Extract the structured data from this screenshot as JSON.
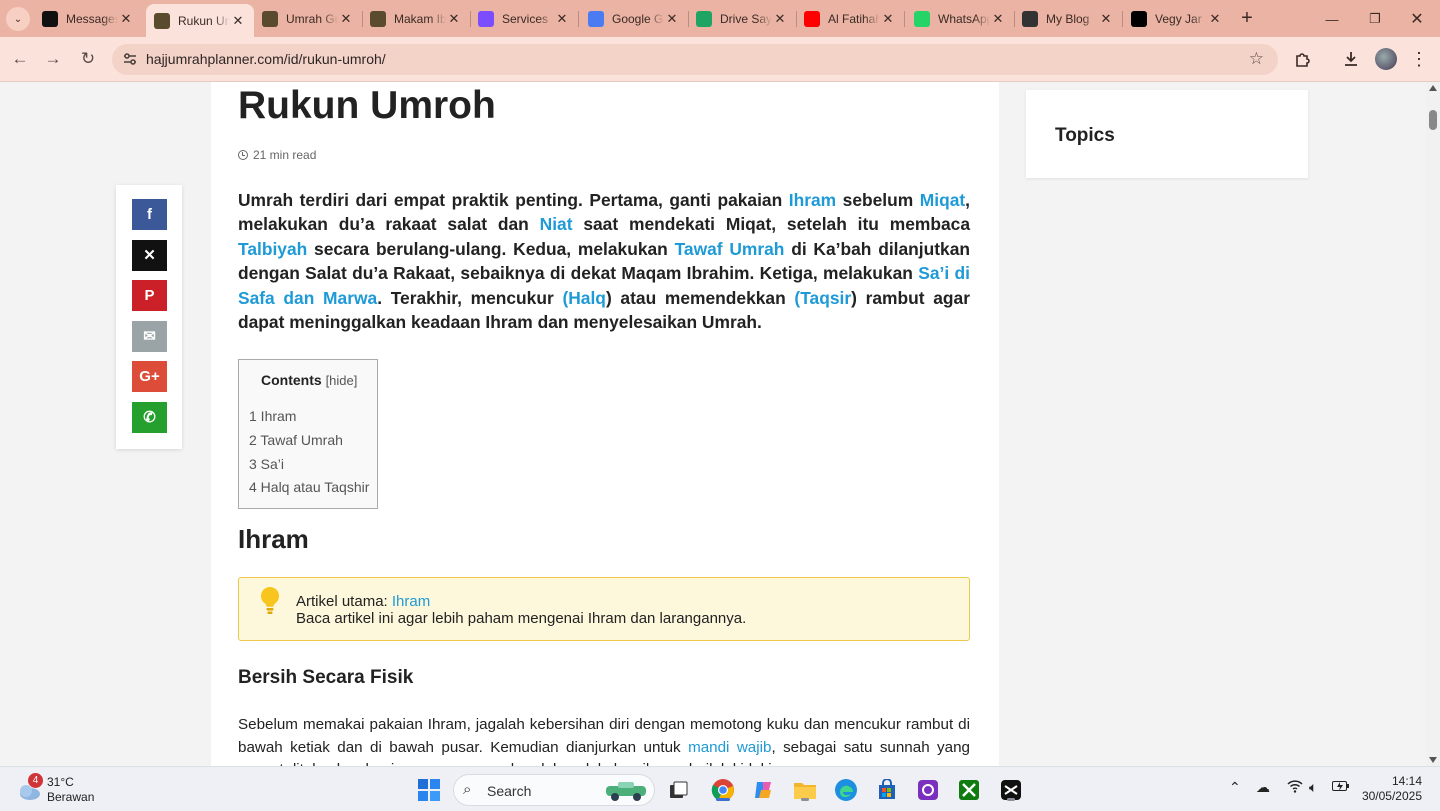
{
  "browser": {
    "tabs": [
      {
        "title": "Messages",
        "favicon": "upwork-icon",
        "color": "#111111"
      },
      {
        "title": "Rukun Umroh",
        "favicon": "kaaba-icon",
        "color": "#5a4a2e",
        "active": true
      },
      {
        "title": "Umrah Guide",
        "favicon": "kaaba-icon",
        "color": "#5a4a2e"
      },
      {
        "title": "Makam Ibrahim",
        "favicon": "kaaba-icon",
        "color": "#5a4a2e"
      },
      {
        "title": "Services",
        "favicon": "services-icon",
        "color": "#7c4dff"
      },
      {
        "title": "Google Gemini",
        "favicon": "gemini-icon",
        "color": "#4a7bf2"
      },
      {
        "title": "Drive Saya",
        "favicon": "drive-icon",
        "color": "#1fa463"
      },
      {
        "title": "Al Fatihah",
        "favicon": "youtube-icon",
        "color": "#ff0000"
      },
      {
        "title": "WhatsApp",
        "favicon": "whatsapp-icon",
        "color": "#25d366"
      },
      {
        "title": "My Blog",
        "favicon": "blog-icon",
        "color": "#333333"
      },
      {
        "title": "Vegy Jar",
        "favicon": "medium-icon",
        "color": "#000000"
      }
    ],
    "url": "hajjumrahplanner.com/id/rukun-umroh/"
  },
  "article": {
    "title": "Rukun Umroh",
    "read_time": "21 min read",
    "intro": {
      "p1": "Umrah terdiri dari empat praktik penting. Pertama, ganti pakaian ",
      "l1": "Ihram",
      "p2": " sebelum ",
      "l2": "Miqat",
      "p3": ", melakukan du’a rakaat salat dan ",
      "l3": "Niat",
      "p4": " saat mendekati Miqat, setelah itu membaca ",
      "l4": "Talbiyah",
      "p5": " secara berulang-ulang. Kedua, melakukan ",
      "l5": "Tawaf Umrah",
      "p6": " di Ka’bah dilanjutkan dengan Salat du’a Rakaat, sebaiknya di dekat Maqam Ibrahim. Ketiga, melakukan ",
      "l6": "Sa’i di Safa dan Marwa",
      "p7": ". Terakhir, mencukur ",
      "l7": "(Halq",
      "p8": ") atau memendekkan ",
      "l8": "(Taqsir",
      "p9": ") rambut agar dapat meninggalkan keadaan Ihram dan menyelesaikan Umrah."
    },
    "toc": {
      "heading": "Contents",
      "hide": "[hide]",
      "items": [
        "1 Ihram",
        "2 Tawaf Umrah",
        "3 Sa’i",
        "4 Halq atau Taqshir"
      ]
    },
    "section1": {
      "heading": "Ihram",
      "notice_label": "Artikel utama: ",
      "notice_link": "Ihram",
      "notice_text": "Baca artikel ini agar lebih paham mengenai Ihram dan larangannya.",
      "subheading": "Bersih Secara Fisik",
      "para_a": "Sebelum memakai pakaian Ihram, jagalah kebersihan diri dengan memotong kuku dan mencukur rambut di bawah ketiak dan di bawah pusar. Kemudian dianjurkan untuk ",
      "para_link": "mandi wajib",
      "para_b": ", sebagai satu sunnah yang sangat ditekankan bagi seseorang yang hendak melakukan ihram, baik laki-laki maupun perempuan."
    }
  },
  "share_buttons": [
    {
      "name": "facebook-share-button",
      "glyph": "f",
      "color": "#3b5998"
    },
    {
      "name": "x-share-button",
      "glyph": "✕",
      "color": "#111111"
    },
    {
      "name": "pinterest-share-button",
      "glyph": "P",
      "color": "#cb2027"
    },
    {
      "name": "email-share-button",
      "glyph": "✉",
      "color": "#9aa4a6"
    },
    {
      "name": "googleplus-share-button",
      "glyph": "G+",
      "color": "#dd4b39"
    },
    {
      "name": "whatsapp-share-button",
      "glyph": "✆",
      "color": "#25a02e"
    }
  ],
  "sidebar": {
    "widget_title": "Topics"
  },
  "taskbar": {
    "weather_badge": "4",
    "temperature": "31°C",
    "condition": "Berawan",
    "search_placeholder": "Search",
    "time": "14:14",
    "date": "30/05/2025"
  }
}
